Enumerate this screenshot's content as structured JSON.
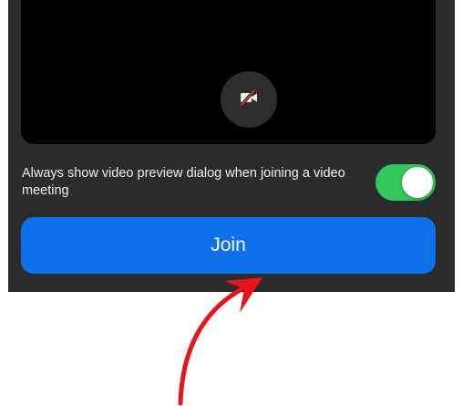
{
  "video_preview": {
    "camera_icon": "video-off-icon"
  },
  "preview_option": {
    "label": "Always show video preview dialog when joining a video meeting",
    "toggle_state": "on",
    "toggle_color": "#34c759"
  },
  "join_button": {
    "label": "Join",
    "color": "#0e71eb"
  },
  "annotation": {
    "arrow_color": "#e8141c",
    "arrow_target": "join-button"
  }
}
